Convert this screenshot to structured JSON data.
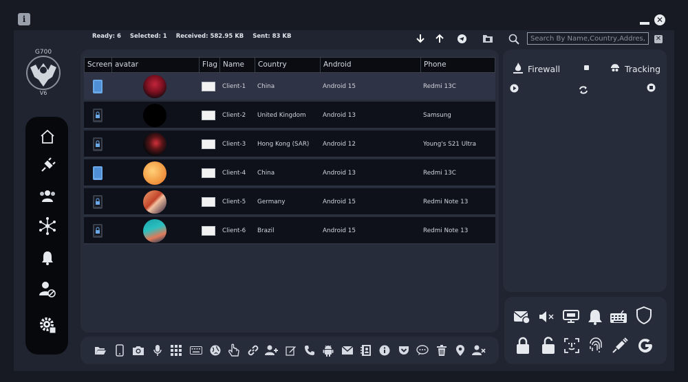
{
  "status": {
    "ready": "Ready: 6",
    "selected": "Selected: 1",
    "received": "Received: 582.95 KB",
    "sent": "Sent: 83 KB"
  },
  "search": {
    "placeholder": "Search By Name,Country,Addres,..."
  },
  "logo": {
    "text_top": "G700",
    "text_bottom": "V6"
  },
  "sidebar": {
    "items": [
      {
        "icon": "home-icon"
      },
      {
        "icon": "plug-icon"
      },
      {
        "icon": "users-icon"
      },
      {
        "icon": "network-icon"
      },
      {
        "icon": "bell-icon"
      },
      {
        "icon": "user-block-icon"
      },
      {
        "icon": "settings-icon"
      }
    ]
  },
  "table": {
    "columns": [
      "Screen",
      "avatar",
      "Flag",
      "Name",
      "Country",
      "Android",
      "Phone"
    ],
    "rows": [
      {
        "name": "Client-1",
        "country": "China",
        "android": "Android 15",
        "phone": "Redmi 13C",
        "screen": "unlocked",
        "selected": true
      },
      {
        "name": "Client-2",
        "country": "United Kingdom",
        "android": "Android 13",
        "phone": "Samsung",
        "screen": "locked",
        "selected": false
      },
      {
        "name": "Client-3",
        "country": "Hong Kong (SAR)",
        "android": "Android 12",
        "phone": "Young's S21 Ultra",
        "screen": "locked",
        "selected": false
      },
      {
        "name": "Client-4",
        "country": "China",
        "android": "Android 13",
        "phone": "Redmi 13C",
        "screen": "unlocked",
        "selected": false
      },
      {
        "name": "Client-5",
        "country": "Germany",
        "android": "Android 15",
        "phone": "Redmi Note 13",
        "screen": "locked",
        "selected": false
      },
      {
        "name": "Client-6",
        "country": "Brazil",
        "android": "Android 15",
        "phone": "Redmi Note 13",
        "screen": "locked",
        "selected": false
      }
    ]
  },
  "right_panel": {
    "firewall_label": "Firewall",
    "tracking_label": "Tracking"
  },
  "colors": {
    "accent": "#272c3a",
    "background": "#1f2430",
    "selected_row": "#2e3445"
  }
}
